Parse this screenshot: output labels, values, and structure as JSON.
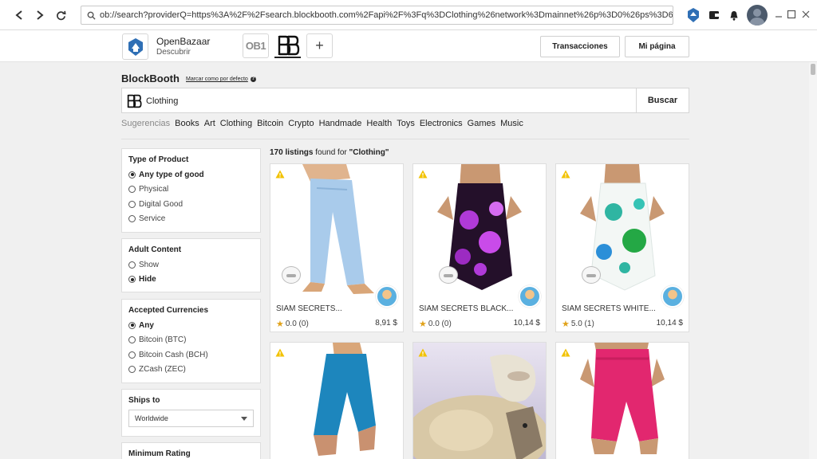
{
  "browser": {
    "url": "ob://search?providerQ=https%3A%2F%2Fsearch.blockbooth.com%2Fapi%2F%3Fq%3DClothing%26network%3Dmainnet%26p%3D0%26ps%3D66%2("
  },
  "header": {
    "brand_name": "OpenBazaar",
    "brand_sub": "Descubrir",
    "ob1_label": "OB1",
    "add_label": "+",
    "transactions_label": "Transacciones",
    "my_page_label": "Mi página"
  },
  "search": {
    "provider": "BlockBooth",
    "set_default": "Marcar como por defecto",
    "query": "Clothing",
    "button": "Buscar",
    "suggestions_label": "Sugerencias",
    "suggestions": [
      "Books",
      "Art",
      "Clothing",
      "Bitcoin",
      "Crypto",
      "Handmade",
      "Health",
      "Toys",
      "Electronics",
      "Games",
      "Music"
    ]
  },
  "filters": {
    "type": {
      "title": "Type of Product",
      "options": [
        "Any type of good",
        "Physical",
        "Digital Good",
        "Service"
      ],
      "selected": 0
    },
    "adult": {
      "title": "Adult Content",
      "options": [
        "Show",
        "Hide"
      ],
      "selected": 1
    },
    "currencies": {
      "title": "Accepted Currencies",
      "options": [
        "Any",
        "Bitcoin (BTC)",
        "Bitcoin Cash (BCH)",
        "ZCash (ZEC)"
      ],
      "selected": 0
    },
    "ships": {
      "title": "Ships to",
      "value": "Worldwide"
    },
    "rating": {
      "title": "Minimum Rating"
    }
  },
  "results": {
    "count": "170 listings",
    "found_for": "found for",
    "query_quoted": "\"Clothing\"",
    "listings": [
      {
        "title": "SIAM SECRETS...",
        "rating": "0.0 (0)",
        "price": "8,91 $",
        "kind": "pants",
        "color": "#9cc4e8"
      },
      {
        "title": "SIAM SECRETS BLACK...",
        "rating": "0.0 (0)",
        "price": "10,14 $",
        "kind": "dress",
        "color": "#2a0d2a"
      },
      {
        "title": "SIAM SECRETS WHITE...",
        "rating": "5.0 (1)",
        "price": "10,14 $",
        "kind": "dress-white",
        "color": "#f4f8f6"
      },
      {
        "kind": "pants-blue",
        "color": "#1e8bc3"
      },
      {
        "kind": "sheep",
        "color": "#d6c7a8"
      },
      {
        "kind": "jumpsuit",
        "color": "#e0246e"
      }
    ]
  },
  "colors": {
    "star": "#e0a21a",
    "warning": "#f2c200"
  }
}
